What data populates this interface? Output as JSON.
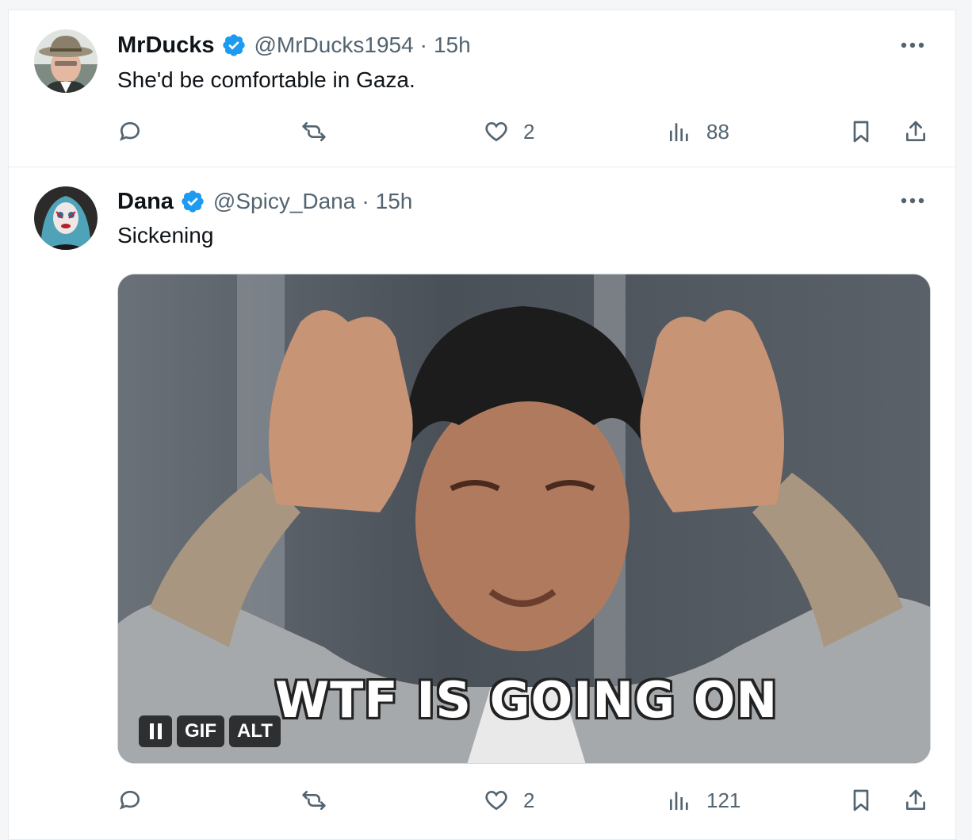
{
  "tweets": [
    {
      "display_name": "MrDucks",
      "handle": "@MrDucks1954",
      "separator": "·",
      "time": "15h",
      "text": "She'd be comfortable in Gaza.",
      "verified": true,
      "metrics": {
        "replies": "",
        "retweets": "",
        "likes": "2",
        "views": "88"
      }
    },
    {
      "display_name": "Dana",
      "handle": "@Spicy_Dana",
      "separator": "·",
      "time": "15h",
      "text": "Sickening",
      "verified": true,
      "media": {
        "type": "gif",
        "caption": "WTF IS GOING ON",
        "controls": {
          "gif_label": "GIF",
          "alt_label": "ALT"
        }
      },
      "metrics": {
        "replies": "",
        "retweets": "",
        "likes": "2",
        "views": "121"
      }
    }
  ],
  "colors": {
    "accent": "#1d9bf0",
    "muted": "#536471",
    "text": "#0f1419",
    "border": "#e6ecf0"
  },
  "icons": [
    "reply-icon",
    "retweet-icon",
    "like-icon",
    "views-icon",
    "bookmark-icon",
    "share-icon",
    "more-icon",
    "verified-badge-icon"
  ]
}
